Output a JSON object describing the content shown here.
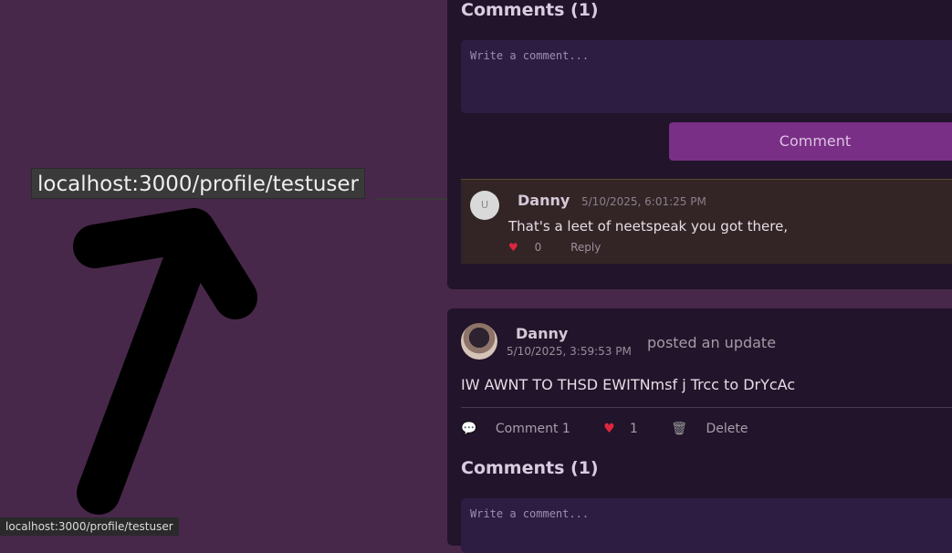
{
  "link_tooltip": "localhost:3000/profile/testuser",
  "status_bar_url": "localhost:3000/profile/testuser",
  "card1": {
    "comments_title": "Comments (1)",
    "comment_placeholder": "Write a comment...",
    "comment_button": "Comment",
    "comment": {
      "avatar_letter": "U",
      "author": "Danny",
      "timestamp": "5/10/2025, 6:01:25 PM",
      "text": "That's a leet of neetspeak you got there,",
      "likes": "0",
      "reply_label": "Reply"
    }
  },
  "post": {
    "author": "Danny",
    "timestamp": "5/10/2025, 3:59:53 PM",
    "action_text": "posted an update",
    "text": "IW AWNT TO THSD EWITNmsf j Trcc to DrYcAc",
    "comment_action": "Comment 1",
    "likes": "1",
    "delete_label": "Delete",
    "comments_title": "Comments (1)",
    "comment_placeholder": "Write a comment..."
  },
  "icons": {
    "heart": "heart-icon",
    "speech": "speech-bubble-icon",
    "trash": "trash-icon"
  },
  "colors": {
    "page_bg": "#48284a",
    "card_bg": "#22142a",
    "button_bg": "#7a2f86",
    "heart": "#e0263e"
  }
}
